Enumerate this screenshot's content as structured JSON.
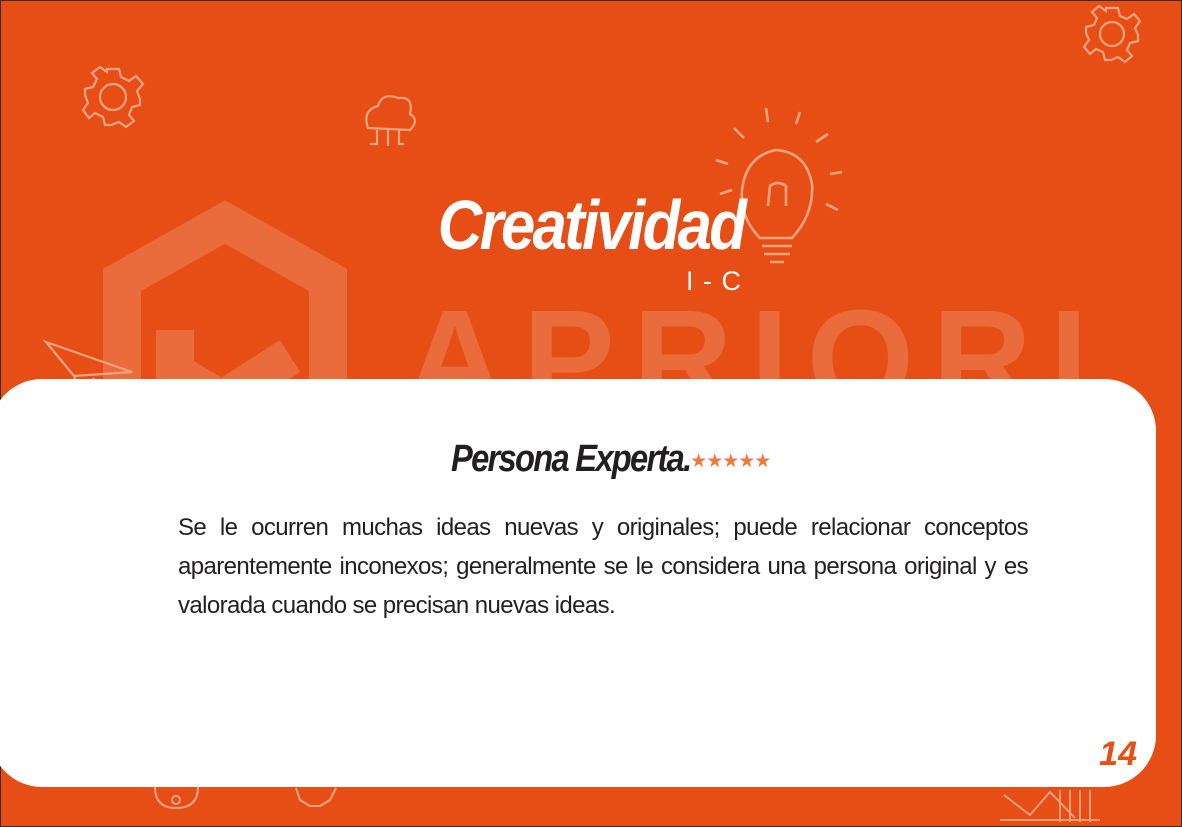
{
  "header": {
    "title": "Creatividad",
    "code": "I - C"
  },
  "card": {
    "level": "Persona Experta.",
    "stars": "★★★★★",
    "description": "Se le ocurren muchas ideas nuevas y originales; puede relacionar conceptos aparentemente inconexos; generalmente se le considera una persona original y es valorada cuando se precisan nuevas ideas."
  },
  "page_number": "14",
  "watermark": "APRIORI",
  "colors": {
    "background": "#e64e15",
    "card": "#ffffff",
    "text": "#231f20",
    "accent": "#e74f15",
    "stars": "#f07a42"
  },
  "icons": [
    "gear-icon",
    "cloud-network-icon",
    "lightbulb-icon",
    "paper-plane-icon",
    "lock-icon",
    "chart-icon"
  ]
}
